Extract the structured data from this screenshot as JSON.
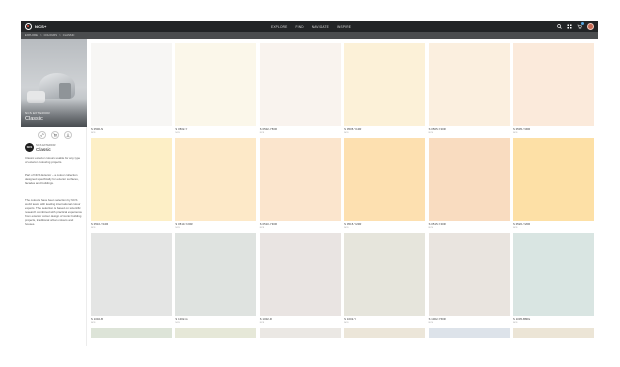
{
  "app": {
    "name": "NCS+"
  },
  "nav": [
    "EXPLORE",
    "FIND",
    "NAVIGATE",
    "INSPIRE"
  ],
  "breadcrumb": [
    "EXPLORE",
    "COLOURS",
    "CLASSIC"
  ],
  "hero": {
    "subtitle": "NCS EXTERIOR",
    "title": "Classic"
  },
  "sidebar": {
    "brand_badge": "NCS",
    "subtitle": "NCS EXTERIOR",
    "title": "Classic",
    "paragraphs": [
      "Classic exterior colours usable for any type of exterior colouring projects.",
      "Part of NCS Exterior – a colour collection designed specifically for exterior surfaces, facades and buildings.",
      "The colours have been selection by NCS world team with leading international colour experts. The selection is based on scientific research combined with practical experience from exterior colour design of iconic building projects, traditional urban colours and houses."
    ]
  },
  "icons": {
    "top": [
      "search-icon",
      "grid-icon",
      "cart-icon",
      "avatar"
    ],
    "actions": [
      "link-icon",
      "cart-icon",
      "download-icon"
    ]
  },
  "swatches": [
    {
      "code": "S 0500-N",
      "label": "NCS",
      "color": "#f7f6f4"
    },
    {
      "code": "S 0502-Y",
      "label": "NCS",
      "color": "#fbf7ea"
    },
    {
      "code": "S 0502-Y50R",
      "label": "NCS",
      "color": "#f9f3ee"
    },
    {
      "code": "S 0505-Y10R",
      "label": "NCS",
      "color": "#fcf1d8"
    },
    {
      "code": "S 0505-Y20R",
      "label": "NCS",
      "color": "#fbefdf"
    },
    {
      "code": "S 0505-Y30R",
      "label": "NCS",
      "color": "#fbeadb"
    },
    {
      "code": "S 0510-Y10R",
      "label": "NCS",
      "color": "#fdefc6"
    },
    {
      "code": "S 0510-Y20R",
      "label": "NCS",
      "color": "#fde9c8"
    },
    {
      "code": "S 0510-Y30R",
      "label": "NCS",
      "color": "#fbe5cd"
    },
    {
      "code": "S 0515-Y20R",
      "label": "NCS",
      "color": "#fde0b0"
    },
    {
      "code": "S 0515-Y40R",
      "label": "NCS",
      "color": "#f9dcc0"
    },
    {
      "code": "S 0520-Y20R",
      "label": "NCS",
      "color": "#fde0a6"
    },
    {
      "code": "S 1002-B",
      "label": "NCS",
      "color": "#e4e5e4"
    },
    {
      "code": "S 1002-G",
      "label": "NCS",
      "color": "#dfe3e0"
    },
    {
      "code": "S 1002-R",
      "label": "NCS",
      "color": "#e9e4e2"
    },
    {
      "code": "S 1002-Y",
      "label": "NCS",
      "color": "#e6e5dc"
    },
    {
      "code": "S 1002-Y50R",
      "label": "NCS",
      "color": "#e9e4df"
    },
    {
      "code": "S 1005-B80G",
      "label": "NCS",
      "color": "#d9e5e2"
    },
    {
      "code": "",
      "label": "",
      "color": "#dde4d8"
    },
    {
      "code": "",
      "label": "",
      "color": "#e6e8d8"
    },
    {
      "code": "",
      "label": "",
      "color": "#ebe8e4"
    },
    {
      "code": "",
      "label": "",
      "color": "#ece6d9"
    },
    {
      "code": "",
      "label": "",
      "color": "#dde3ea"
    },
    {
      "code": "",
      "label": "",
      "color": "#ece5d6"
    }
  ]
}
